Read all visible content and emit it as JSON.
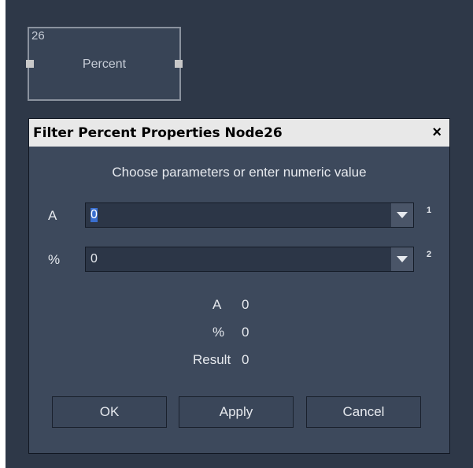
{
  "node": {
    "id": "26",
    "label": "Percent"
  },
  "dialog": {
    "title": "Filter Percent Properties Node26",
    "close_glyph": "×",
    "instructions": "Choose parameters or enter numeric value",
    "params": [
      {
        "label": "A",
        "value": "0",
        "index": "1"
      },
      {
        "label": "%",
        "value": "0",
        "index": "2"
      }
    ],
    "summary": [
      {
        "label": "A",
        "value": "0"
      },
      {
        "label": "%",
        "value": "0"
      },
      {
        "label": "Result",
        "value": "0"
      }
    ],
    "buttons": {
      "ok": "OK",
      "apply": "Apply",
      "cancel": "Cancel"
    }
  },
  "colors": {
    "background": "#2e3848",
    "dialog": "#3d495c",
    "titlebar": "#e8e8e8"
  },
  "icons": {
    "dropdown": "chevron-down-icon",
    "close": "close-icon"
  }
}
